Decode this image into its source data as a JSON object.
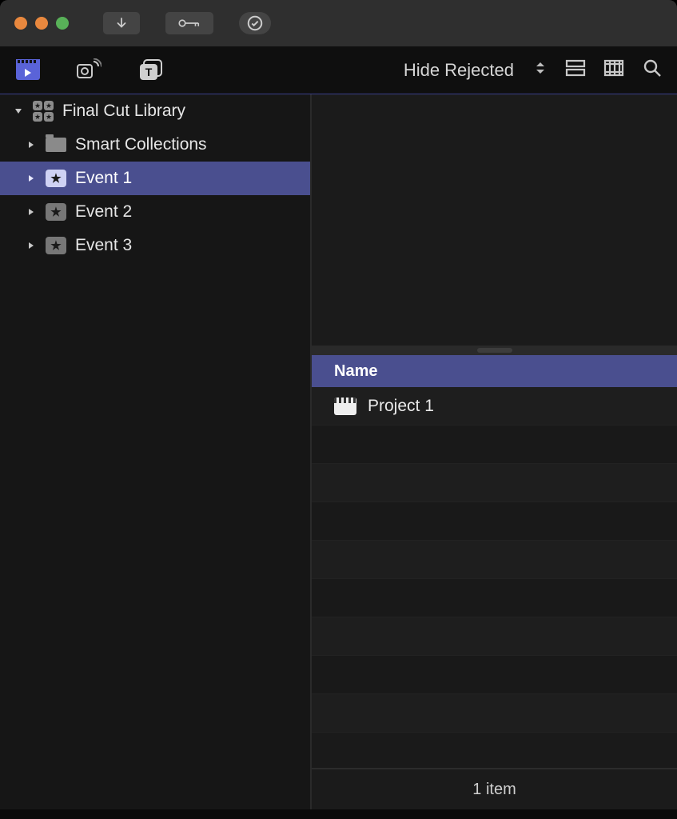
{
  "sidebar": {
    "library_label": "Final Cut Library",
    "smart_label": "Smart Collections",
    "events": [
      {
        "label": "Event 1",
        "selected": true
      },
      {
        "label": "Event 2",
        "selected": false
      },
      {
        "label": "Event 3",
        "selected": false
      }
    ]
  },
  "toolbar": {
    "filter_label": "Hide Rejected"
  },
  "table": {
    "header_name": "Name",
    "rows": [
      {
        "label": "Project 1"
      }
    ]
  },
  "footer": {
    "count_text": "1 item"
  }
}
